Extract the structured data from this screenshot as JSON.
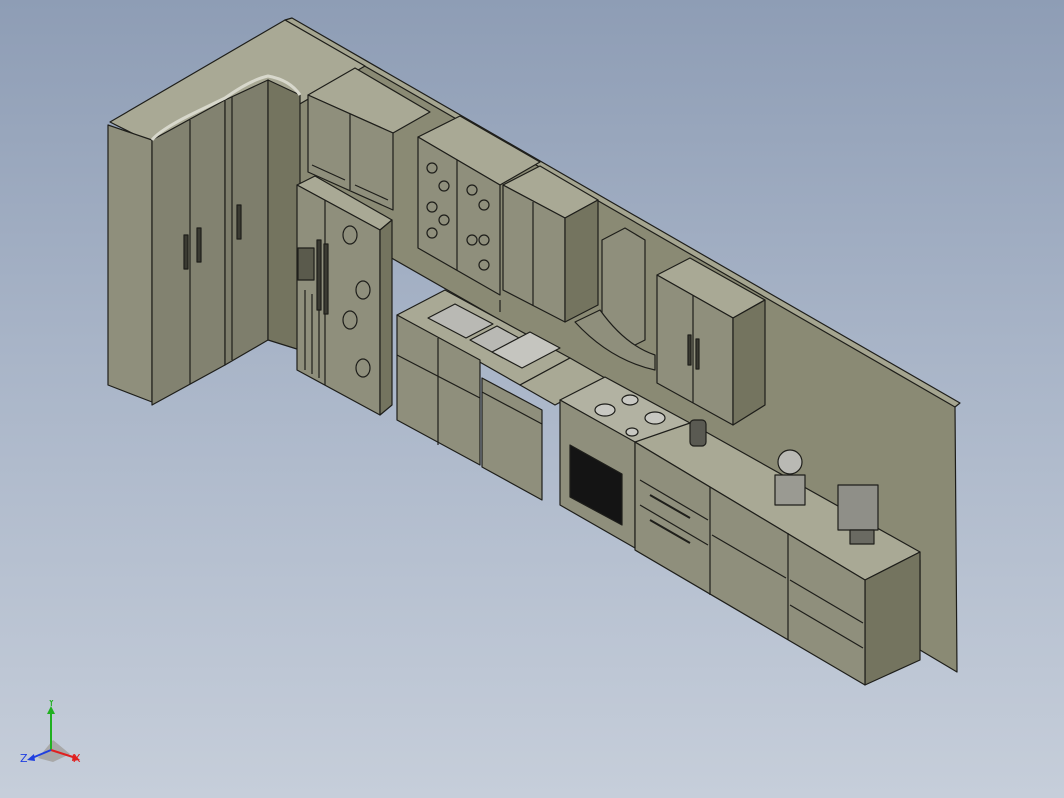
{
  "app": {
    "view": "isometric-3d-model-viewport"
  },
  "scene": {
    "name": "kitchen-assembly"
  },
  "triad": {
    "x_label": "X",
    "y_label": "Y",
    "z_label": "Z"
  },
  "colors": {
    "face_front": "#8f8f7c",
    "face_top": "#a9a995",
    "face_side": "#74745f",
    "wall": "#8a8a74",
    "outline": "#1e1e1a",
    "oven_glass": "#141414",
    "steel": "#b9b9b4",
    "axis_x": "#e02020",
    "axis_y": "#20b020",
    "axis_z": "#2040e0"
  }
}
